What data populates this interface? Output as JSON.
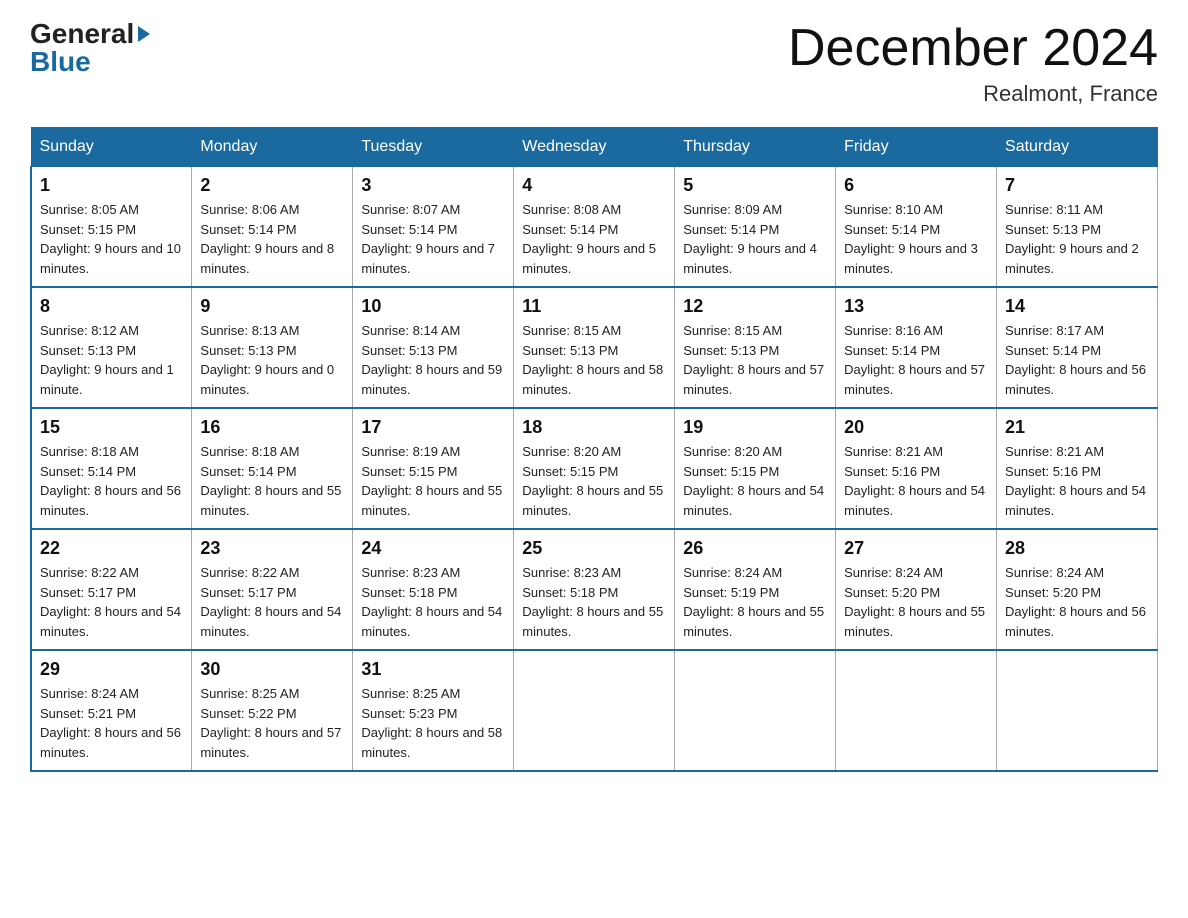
{
  "header": {
    "logo_general": "General",
    "logo_blue": "Blue",
    "month_title": "December 2024",
    "location": "Realmont, France"
  },
  "calendar": {
    "days_of_week": [
      "Sunday",
      "Monday",
      "Tuesday",
      "Wednesday",
      "Thursday",
      "Friday",
      "Saturday"
    ],
    "weeks": [
      [
        {
          "day": "1",
          "sunrise": "8:05 AM",
          "sunset": "5:15 PM",
          "daylight": "9 hours and 10 minutes."
        },
        {
          "day": "2",
          "sunrise": "8:06 AM",
          "sunset": "5:14 PM",
          "daylight": "9 hours and 8 minutes."
        },
        {
          "day": "3",
          "sunrise": "8:07 AM",
          "sunset": "5:14 PM",
          "daylight": "9 hours and 7 minutes."
        },
        {
          "day": "4",
          "sunrise": "8:08 AM",
          "sunset": "5:14 PM",
          "daylight": "9 hours and 5 minutes."
        },
        {
          "day": "5",
          "sunrise": "8:09 AM",
          "sunset": "5:14 PM",
          "daylight": "9 hours and 4 minutes."
        },
        {
          "day": "6",
          "sunrise": "8:10 AM",
          "sunset": "5:14 PM",
          "daylight": "9 hours and 3 minutes."
        },
        {
          "day": "7",
          "sunrise": "8:11 AM",
          "sunset": "5:13 PM",
          "daylight": "9 hours and 2 minutes."
        }
      ],
      [
        {
          "day": "8",
          "sunrise": "8:12 AM",
          "sunset": "5:13 PM",
          "daylight": "9 hours and 1 minute."
        },
        {
          "day": "9",
          "sunrise": "8:13 AM",
          "sunset": "5:13 PM",
          "daylight": "9 hours and 0 minutes."
        },
        {
          "day": "10",
          "sunrise": "8:14 AM",
          "sunset": "5:13 PM",
          "daylight": "8 hours and 59 minutes."
        },
        {
          "day": "11",
          "sunrise": "8:15 AM",
          "sunset": "5:13 PM",
          "daylight": "8 hours and 58 minutes."
        },
        {
          "day": "12",
          "sunrise": "8:15 AM",
          "sunset": "5:13 PM",
          "daylight": "8 hours and 57 minutes."
        },
        {
          "day": "13",
          "sunrise": "8:16 AM",
          "sunset": "5:14 PM",
          "daylight": "8 hours and 57 minutes."
        },
        {
          "day": "14",
          "sunrise": "8:17 AM",
          "sunset": "5:14 PM",
          "daylight": "8 hours and 56 minutes."
        }
      ],
      [
        {
          "day": "15",
          "sunrise": "8:18 AM",
          "sunset": "5:14 PM",
          "daylight": "8 hours and 56 minutes."
        },
        {
          "day": "16",
          "sunrise": "8:18 AM",
          "sunset": "5:14 PM",
          "daylight": "8 hours and 55 minutes."
        },
        {
          "day": "17",
          "sunrise": "8:19 AM",
          "sunset": "5:15 PM",
          "daylight": "8 hours and 55 minutes."
        },
        {
          "day": "18",
          "sunrise": "8:20 AM",
          "sunset": "5:15 PM",
          "daylight": "8 hours and 55 minutes."
        },
        {
          "day": "19",
          "sunrise": "8:20 AM",
          "sunset": "5:15 PM",
          "daylight": "8 hours and 54 minutes."
        },
        {
          "day": "20",
          "sunrise": "8:21 AM",
          "sunset": "5:16 PM",
          "daylight": "8 hours and 54 minutes."
        },
        {
          "day": "21",
          "sunrise": "8:21 AM",
          "sunset": "5:16 PM",
          "daylight": "8 hours and 54 minutes."
        }
      ],
      [
        {
          "day": "22",
          "sunrise": "8:22 AM",
          "sunset": "5:17 PM",
          "daylight": "8 hours and 54 minutes."
        },
        {
          "day": "23",
          "sunrise": "8:22 AM",
          "sunset": "5:17 PM",
          "daylight": "8 hours and 54 minutes."
        },
        {
          "day": "24",
          "sunrise": "8:23 AM",
          "sunset": "5:18 PM",
          "daylight": "8 hours and 54 minutes."
        },
        {
          "day": "25",
          "sunrise": "8:23 AM",
          "sunset": "5:18 PM",
          "daylight": "8 hours and 55 minutes."
        },
        {
          "day": "26",
          "sunrise": "8:24 AM",
          "sunset": "5:19 PM",
          "daylight": "8 hours and 55 minutes."
        },
        {
          "day": "27",
          "sunrise": "8:24 AM",
          "sunset": "5:20 PM",
          "daylight": "8 hours and 55 minutes."
        },
        {
          "day": "28",
          "sunrise": "8:24 AM",
          "sunset": "5:20 PM",
          "daylight": "8 hours and 56 minutes."
        }
      ],
      [
        {
          "day": "29",
          "sunrise": "8:24 AM",
          "sunset": "5:21 PM",
          "daylight": "8 hours and 56 minutes."
        },
        {
          "day": "30",
          "sunrise": "8:25 AM",
          "sunset": "5:22 PM",
          "daylight": "8 hours and 57 minutes."
        },
        {
          "day": "31",
          "sunrise": "8:25 AM",
          "sunset": "5:23 PM",
          "daylight": "8 hours and 58 minutes."
        },
        null,
        null,
        null,
        null
      ]
    ],
    "labels": {
      "sunrise": "Sunrise:",
      "sunset": "Sunset:",
      "daylight": "Daylight:"
    }
  }
}
